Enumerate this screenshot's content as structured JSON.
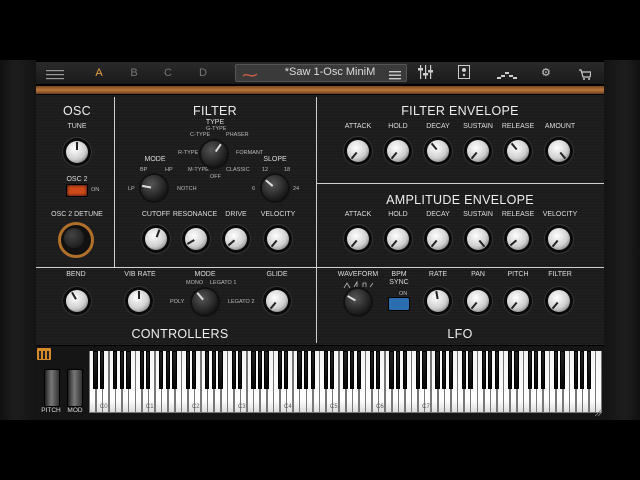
{
  "toolbar": {
    "preset_slots": [
      "A",
      "B",
      "C",
      "D"
    ],
    "active_slot": "A",
    "preset_name": "*Saw 1-Osc MiniM",
    "icons": [
      "hamburger-icon",
      "shuffle-icon",
      "list-icon",
      "mixer-icon",
      "effects-icon",
      "sequence-icon",
      "gear-icon",
      "cart-icon"
    ]
  },
  "osc": {
    "title": "OSC",
    "tune_label": "TUNE",
    "osc2_label": "OSC 2",
    "osc2_on_label": "ON",
    "detune_label": "OSC 2 DETUNE"
  },
  "filter": {
    "title": "FILTER",
    "type_label": "TYPE",
    "type_options": [
      "C-TYPE",
      "G-TYPE",
      "PHASER",
      "R-TYPE",
      "FORMANT",
      "M-TYPE",
      "OFF",
      "CLASSIC"
    ],
    "mode_label": "MODE",
    "mode_options": [
      "BP",
      "HP",
      "LP",
      "NOTCH"
    ],
    "slope_label": "SLOPE",
    "slope_options": [
      "12",
      "18",
      "6",
      "24"
    ],
    "knobs": [
      "CUTOFF",
      "RESONANCE",
      "DRIVE",
      "VELOCITY"
    ]
  },
  "filter_envelope": {
    "title": "FILTER ENVELOPE",
    "knobs": [
      "ATTACK",
      "HOLD",
      "DECAY",
      "SUSTAIN",
      "RELEASE",
      "AMOUNT"
    ]
  },
  "amplitude_envelope": {
    "title": "AMPLITUDE ENVELOPE",
    "knobs": [
      "ATTACK",
      "HOLD",
      "DECAY",
      "SUSTAIN",
      "RELEASE",
      "VELOCITY"
    ]
  },
  "controllers": {
    "title": "CONTROLLERS",
    "bend_label": "BEND",
    "vib_rate_label": "VIB RATE",
    "mode_label": "MODE",
    "mode_options": [
      "MONO",
      "LEGATO 1",
      "POLY",
      "LEGATO 2"
    ],
    "glide_label": "GLIDE"
  },
  "lfo": {
    "title": "LFO",
    "waveform_label": "WAVEFORM",
    "bpm_sync_label": "BPM SYNC",
    "sync_on_label": "ON",
    "knobs": [
      "RATE",
      "PAN",
      "PITCH",
      "FILTER"
    ]
  },
  "keyboard": {
    "pitch_label": "PITCH",
    "mod_label": "MOD",
    "octave_labels": [
      "C0",
      "C1",
      "C2",
      "C3",
      "C4",
      "C5",
      "C6",
      "C7"
    ]
  }
}
